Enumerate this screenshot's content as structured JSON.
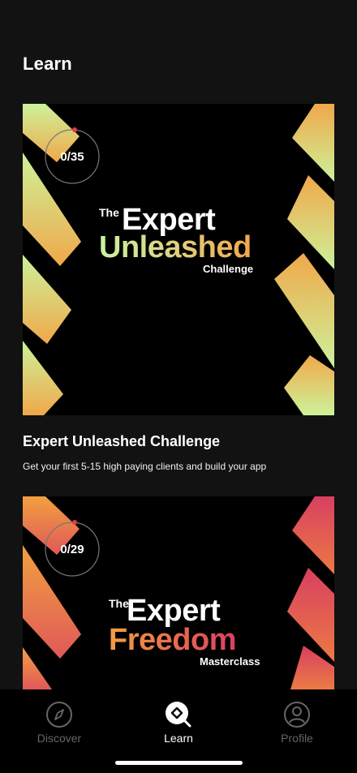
{
  "header": {
    "title": "Learn"
  },
  "courses": [
    {
      "progress": "0/35",
      "progress_fraction": 0.0,
      "logo_the": "The",
      "logo_line1": "Expert",
      "logo_line2": "Unleashed",
      "logo_sub": "Challenge",
      "title": "Expert Unleashed Challenge",
      "description": "Get your first 5-15 high paying clients and build your app"
    },
    {
      "progress": "0/29",
      "progress_fraction": 0.0,
      "logo_the": "The",
      "logo_line1": "Expert",
      "logo_line2": "Freedom",
      "logo_sub": "Masterclass"
    }
  ],
  "tabbar": {
    "tabs": [
      {
        "label": "Discover",
        "icon": "compass-icon",
        "active": false
      },
      {
        "label": "Learn",
        "icon": "learn-search-icon",
        "active": true
      },
      {
        "label": "Profile",
        "icon": "person-icon",
        "active": false
      }
    ]
  },
  "colors": {
    "background": "#121212",
    "card_bg": "#000000",
    "progress_dot": "#e83a4a",
    "tab_inactive": "#666666",
    "tab_active": "#ffffff"
  }
}
